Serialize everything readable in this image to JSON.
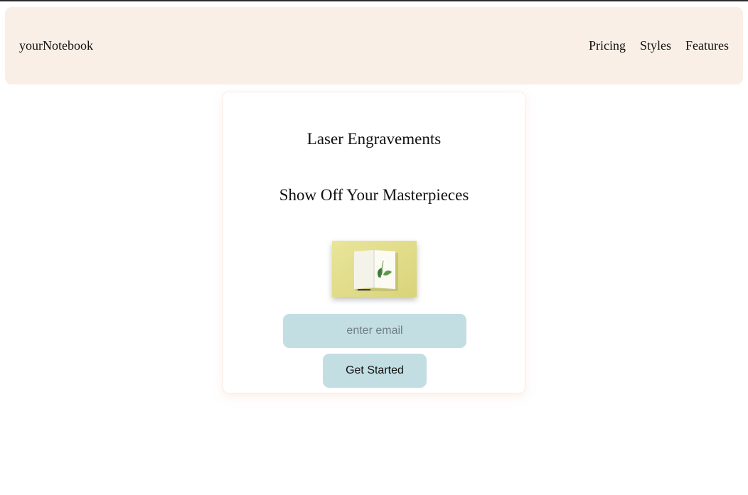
{
  "navbar": {
    "brand": "yourNotebook",
    "links": [
      "Pricing",
      "Styles",
      "Features"
    ]
  },
  "card": {
    "title": "Laser Engravements",
    "subtitle": "Show Off Your Masterpieces",
    "image_subject": "open notebook with leaf on yellow background",
    "email_placeholder": "enter email",
    "cta_label": "Get Started"
  },
  "colors": {
    "navbar_bg": "#faefe6",
    "accent": "#c2dee3",
    "photo_bg": "#e3df8c"
  }
}
